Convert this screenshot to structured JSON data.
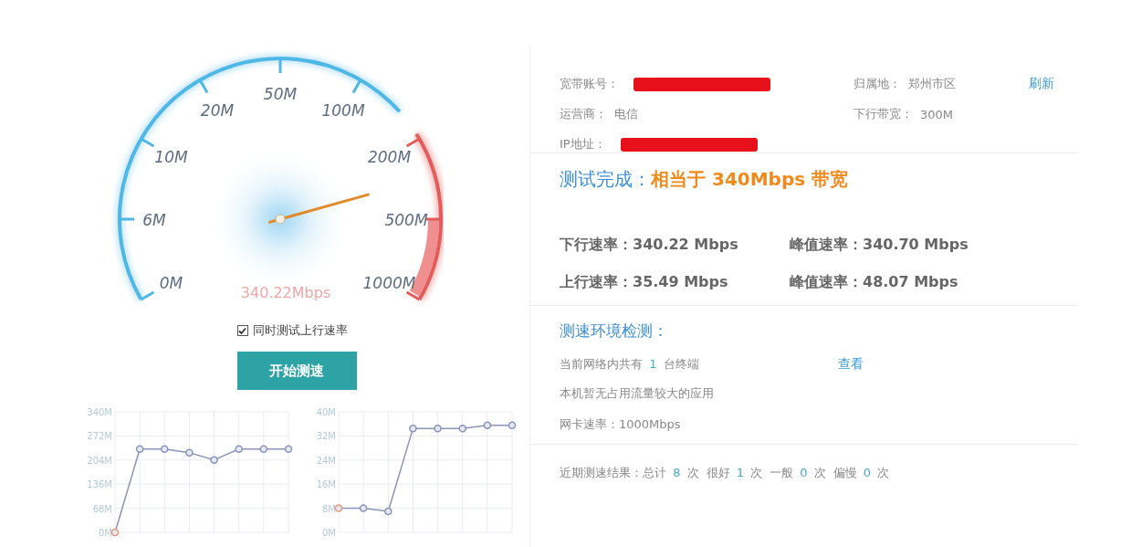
{
  "gauge": {
    "scale_labels": [
      "0M",
      "6M",
      "10M",
      "20M",
      "50M",
      "100M",
      "200M",
      "500M",
      "1000M"
    ],
    "reading": "340.22Mbps"
  },
  "upload_option": {
    "label": "同时测试上行速率",
    "checked": true
  },
  "start_button": {
    "label": "开始测速"
  },
  "charts": [
    {
      "chart_data": {
        "type": "line",
        "grid": true,
        "series": [
          {
            "marker": true,
            "values": [
              0,
              235,
              235,
              225,
              204,
              235,
              235,
              235
            ]
          }
        ],
        "ylim": [
          0,
          340
        ],
        "yticks": [
          {
            "value": 0,
            "label": "0M"
          },
          {
            "value": 68,
            "label": "68M"
          },
          {
            "value": 136,
            "label": "136M"
          },
          {
            "value": 204,
            "label": "204M"
          },
          {
            "value": 272,
            "label": "272M"
          },
          {
            "value": 340,
            "label": "340M"
          }
        ]
      }
    },
    {
      "chart_data": {
        "type": "line",
        "grid": true,
        "series": [
          {
            "marker": true,
            "values": [
              8,
              8,
              7,
              34.5,
              34.5,
              34.5,
              35.5,
              35.5
            ]
          }
        ],
        "ylim": [
          0,
          40
        ],
        "yticks": [
          {
            "value": 0,
            "label": "0M"
          },
          {
            "value": 8,
            "label": "8M"
          },
          {
            "value": 16,
            "label": "16M"
          },
          {
            "value": 24,
            "label": "24M"
          },
          {
            "value": 32,
            "label": "32M"
          },
          {
            "value": 40,
            "label": "40M"
          }
        ]
      }
    }
  ],
  "account": {
    "left": [
      {
        "label": "宽带账号：",
        "redacted": true
      },
      {
        "label": "运营商：",
        "value": "电信"
      },
      {
        "label": "IP地址：",
        "redacted": true
      }
    ],
    "right": [
      {
        "label": "归属地：",
        "value": "郑州市区"
      },
      {
        "label": "下行带宽：",
        "value": "300M"
      }
    ],
    "refresh_link": "刷新"
  },
  "result": {
    "title": "测试完成：",
    "summary": "相当于 340Mbps 带宽"
  },
  "speeds": [
    {
      "rate": "下行速率：340.22 Mbps",
      "peak": "峰值速率：340.70 Mbps"
    },
    {
      "rate": "上行速率：35.49 Mbps",
      "peak": "峰值速率：48.07 Mbps"
    }
  ],
  "environment": {
    "title": "测速环境检测：",
    "devices": {
      "prefix": "当前网络内共有",
      "count": "1",
      "suffix": "台终端",
      "link": "查看"
    },
    "apps": "本机暂无占用流量较大的应用",
    "nic": "网卡速率：1000Mbps"
  },
  "recent": {
    "label": "近期测速结果：",
    "items": [
      {
        "name": "总计",
        "count": "8",
        "unit": "次"
      },
      {
        "name": "很好",
        "count": "1",
        "unit": "次"
      },
      {
        "name": "一般",
        "count": "0",
        "unit": "次"
      },
      {
        "name": "偏慢",
        "count": "0",
        "unit": "次"
      }
    ]
  }
}
